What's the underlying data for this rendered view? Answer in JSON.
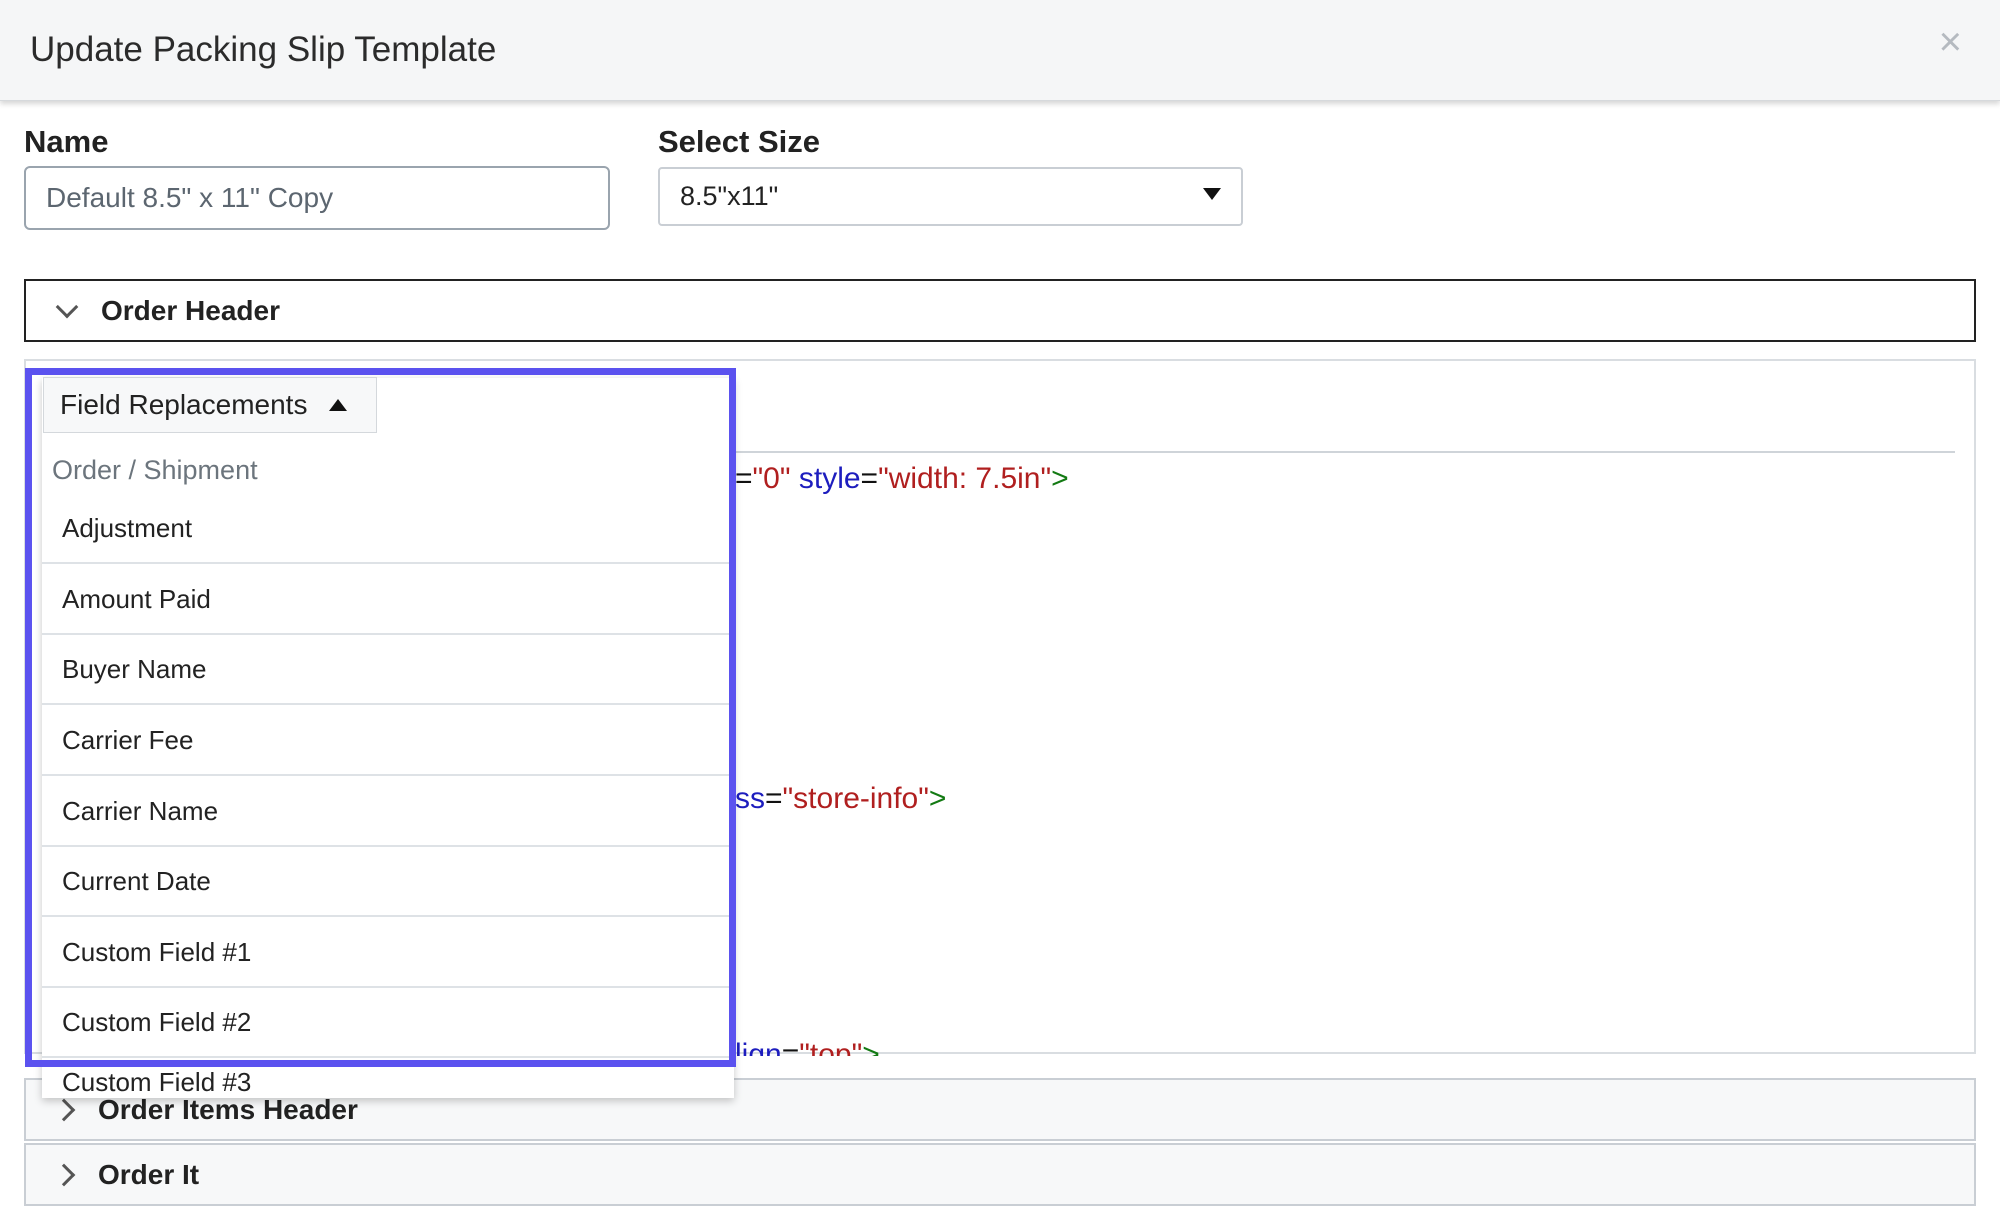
{
  "modal": {
    "title": "Update Packing Slip Template",
    "close_glyph": "×"
  },
  "form": {
    "name_label": "Name",
    "name_value": "Default 8.5\" x 11\" Copy",
    "size_label": "Select Size",
    "size_value": "8.5\"x11\""
  },
  "sections": {
    "order_header": "Order Header",
    "order_items_header": "Order Items Header",
    "order_items_partial": "Order It"
  },
  "code_fragments": {
    "line1": {
      "punct1": "=",
      "str1": "\"0\"",
      "attr1": "style",
      "punct2": "=",
      "str2": "\"width: 7.5in\"",
      "tag": ">"
    },
    "line2": {
      "attr": "ss",
      "punct": "=",
      "str": "\"store-info\"",
      "tag": ">"
    },
    "line3": {
      "attr": "lign",
      "punct": "=",
      "str": "\"top\"",
      "tag": ">"
    }
  },
  "dropdown": {
    "button_label": "Field Replacements",
    "group_label": "Order / Shipment",
    "items": [
      "Adjustment",
      "Amount Paid",
      "Buyer Name",
      "Carrier Fee",
      "Carrier Name",
      "Current Date",
      "Custom Field #1",
      "Custom Field #2",
      "Custom Field #3"
    ]
  },
  "colors": {
    "highlight": "#5b52ef",
    "code_attr": "#1d1dbe",
    "code_string": "#b01f1f",
    "code_tag": "#137a13"
  }
}
